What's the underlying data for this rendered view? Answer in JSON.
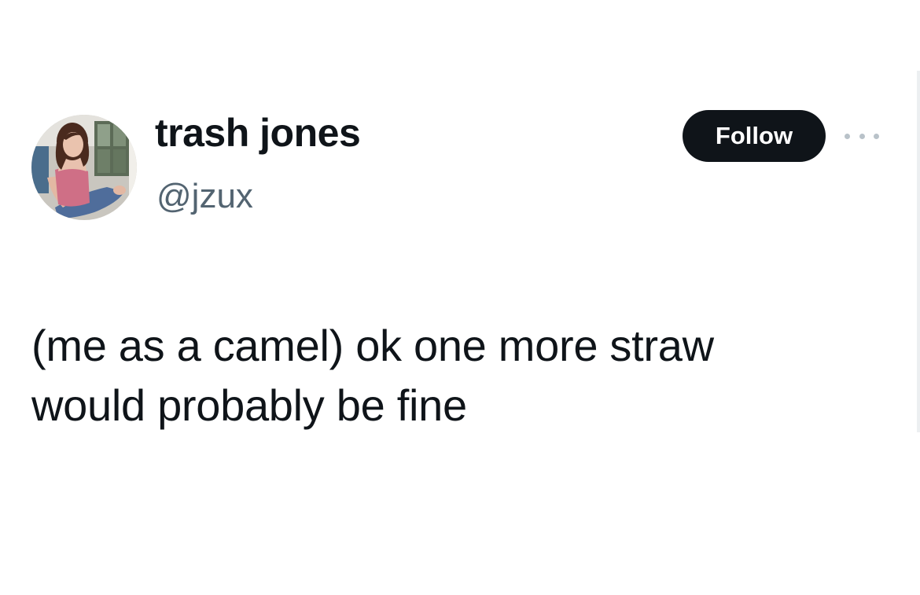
{
  "author": {
    "display_name": "trash jones",
    "handle": "@jzux",
    "avatar_icon": "profile-photo"
  },
  "actions": {
    "follow_label": "Follow",
    "more_icon": "more-horizontal-icon"
  },
  "tweet": {
    "lines": [
      "(me as a camel) ok one more straw",
      "would probably be fine"
    ]
  },
  "colors": {
    "text_primary": "#0f1419",
    "text_secondary": "#536471",
    "follow_bg": "#0f1419",
    "follow_text": "#ffffff",
    "background": "#ffffff"
  }
}
